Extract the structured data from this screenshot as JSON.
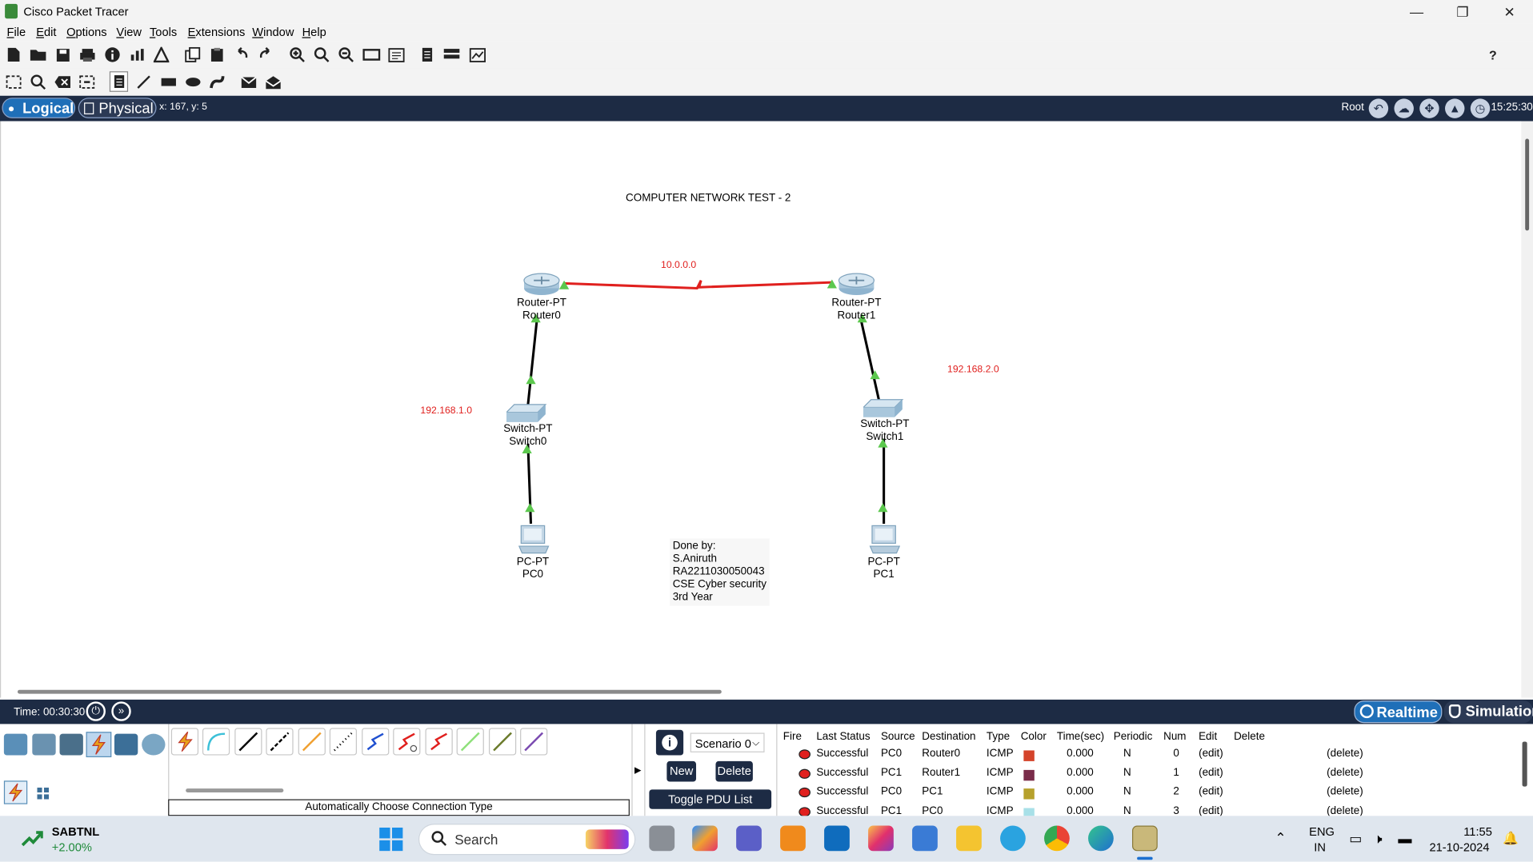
{
  "window": {
    "title": "Cisco Packet Tracer",
    "minimize": "—",
    "maximize": "❐",
    "close": "✕"
  },
  "menu": [
    "File",
    "Edit",
    "Options",
    "View",
    "Tools",
    "Extensions",
    "Window",
    "Help"
  ],
  "toolbar": {
    "help": "?"
  },
  "workspace": {
    "logical_label": "Logical",
    "physical_label": "Physical",
    "coords": "x: 167, y: 5",
    "root_label": "Root",
    "time": "15:25:30"
  },
  "canvas": {
    "title_note": "COMPUTER NETWORK TEST - 2",
    "networks": {
      "wan": "10.0.0.0",
      "lan0": "192.168.1.0",
      "lan1": "192.168.2.0"
    },
    "devices": {
      "router0": {
        "model": "Router-PT",
        "name": "Router0"
      },
      "router1": {
        "model": "Router-PT",
        "name": "Router1"
      },
      "switch0": {
        "model": "Switch-PT",
        "name": "Switch0"
      },
      "switch1": {
        "model": "Switch-PT",
        "name": "Switch1"
      },
      "pc0": {
        "model": "PC-PT",
        "name": "PC0"
      },
      "pc1": {
        "model": "PC-PT",
        "name": "PC1"
      }
    },
    "note_lines": [
      "Done by:",
      "S.Aniruth",
      "RA2211030050043",
      "CSE Cyber security",
      "3rd Year"
    ]
  },
  "timebar": {
    "time": "Time: 00:30:30",
    "realtime": "Realtime",
    "simulation": "Simulation"
  },
  "bottom": {
    "connection_type": "Automatically Choose Connection Type",
    "scenario": "Scenario 0",
    "info_icon": "i",
    "new_button": "New",
    "delete_button": "Delete",
    "toggle_button": "Toggle PDU List Window",
    "pdu_headers": [
      "Fire",
      "Last Status",
      "Source",
      "Destination",
      "Type",
      "Color",
      "Time(sec)",
      "Periodic",
      "Num",
      "Edit",
      "Delete"
    ],
    "pdu_rows": [
      {
        "status": "Successful",
        "source": "PC0",
        "destination": "Router0",
        "type": "ICMP",
        "color": "#d4432a",
        "time": "0.000",
        "periodic": "N",
        "num": "0",
        "edit": "(edit)",
        "delete": "(delete)"
      },
      {
        "status": "Successful",
        "source": "PC1",
        "destination": "Router1",
        "type": "ICMP",
        "color": "#7a2c4a",
        "time": "0.000",
        "periodic": "N",
        "num": "1",
        "edit": "(edit)",
        "delete": "(delete)"
      },
      {
        "status": "Successful",
        "source": "PC0",
        "destination": "PC1",
        "type": "ICMP",
        "color": "#b6a12c",
        "time": "0.000",
        "periodic": "N",
        "num": "2",
        "edit": "(edit)",
        "delete": "(delete)"
      },
      {
        "status": "Successful",
        "source": "PC1",
        "destination": "PC0",
        "type": "ICMP",
        "color": "#a8e0e8",
        "time": "0.000",
        "periodic": "N",
        "num": "3",
        "edit": "(edit)",
        "delete": "(delete)"
      }
    ]
  },
  "taskbar": {
    "stock_name": "SABTNL",
    "stock_change": "+2.00%",
    "search_placeholder": "Search",
    "lang": "ENG",
    "region": "IN",
    "clock": "11:55",
    "date": "21-10-2024"
  },
  "colors": {
    "wan_link": "#e0201e",
    "link": "#000000",
    "port_up": "#5cc84e",
    "accent": "#1d2b44"
  }
}
